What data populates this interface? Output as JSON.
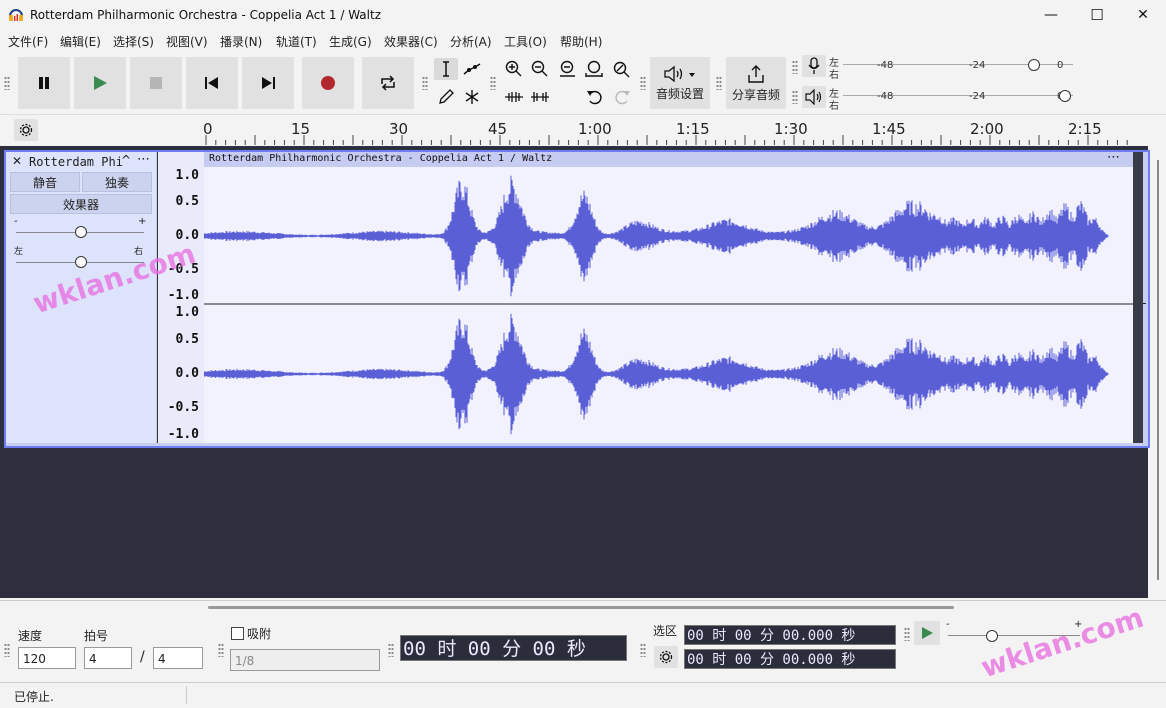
{
  "window": {
    "title": "Rotterdam Philharmonic Orchestra - Coppelia Act 1  /  Waltz",
    "min": "—",
    "max": "☐",
    "close": "✕"
  },
  "menu": [
    "文件(F)",
    "编辑(E)",
    "选择(S)",
    "视图(V)",
    "播录(N)",
    "轨道(T)",
    "生成(G)",
    "效果器(C)",
    "分析(A)",
    "工具(O)",
    "帮助(H)"
  ],
  "toolbar": {
    "audio_settings_label": "音频设置",
    "share_audio_label": "分享音频",
    "meter_rec": {
      "left": "左",
      "right": "右",
      "ticks": [
        "-48",
        "-24",
        "0"
      ]
    },
    "meter_play": {
      "left": "左",
      "right": "右",
      "ticks": [
        "-48",
        "-24",
        "0"
      ]
    }
  },
  "ruler": {
    "ticks": [
      "0",
      "15",
      "30",
      "45",
      "1:00",
      "1:15",
      "1:30",
      "1:45",
      "2:00",
      "2:15"
    ]
  },
  "track": {
    "name": "Rotterdam Phi",
    "mute": "静音",
    "solo": "独奏",
    "effects": "效果器",
    "gain_minus": "-",
    "gain_plus": "+",
    "pan_left": "左",
    "pan_right": "右",
    "clip_name": "Rotterdam Philharmonic Orchestra - Coppelia Act 1  /  Waltz",
    "y_labels": [
      "1.0",
      "0.5",
      "0.0",
      "-0.5",
      "-1.0"
    ]
  },
  "bottom": {
    "tempo_label": "速度",
    "tempo_value": "120",
    "timesig_label": "拍号",
    "timesig_num": "4",
    "timesig_den": "4",
    "snap_label": "吸附",
    "snap_value": "1/8",
    "time_display": "00 时 00 分 00 秒",
    "selection_label": "选区",
    "sel_start": "00 时 00 分 00.000 秒",
    "sel_end": "00 时 00 分 00.000 秒",
    "speed_minus": "-",
    "speed_plus": "+"
  },
  "status": "已停止.",
  "watermarks": [
    "wklan.com",
    "wklan.com"
  ],
  "colors": {
    "waveform": "#5b5fd6",
    "record": "#b3282d",
    "play": "#3a8a52"
  }
}
